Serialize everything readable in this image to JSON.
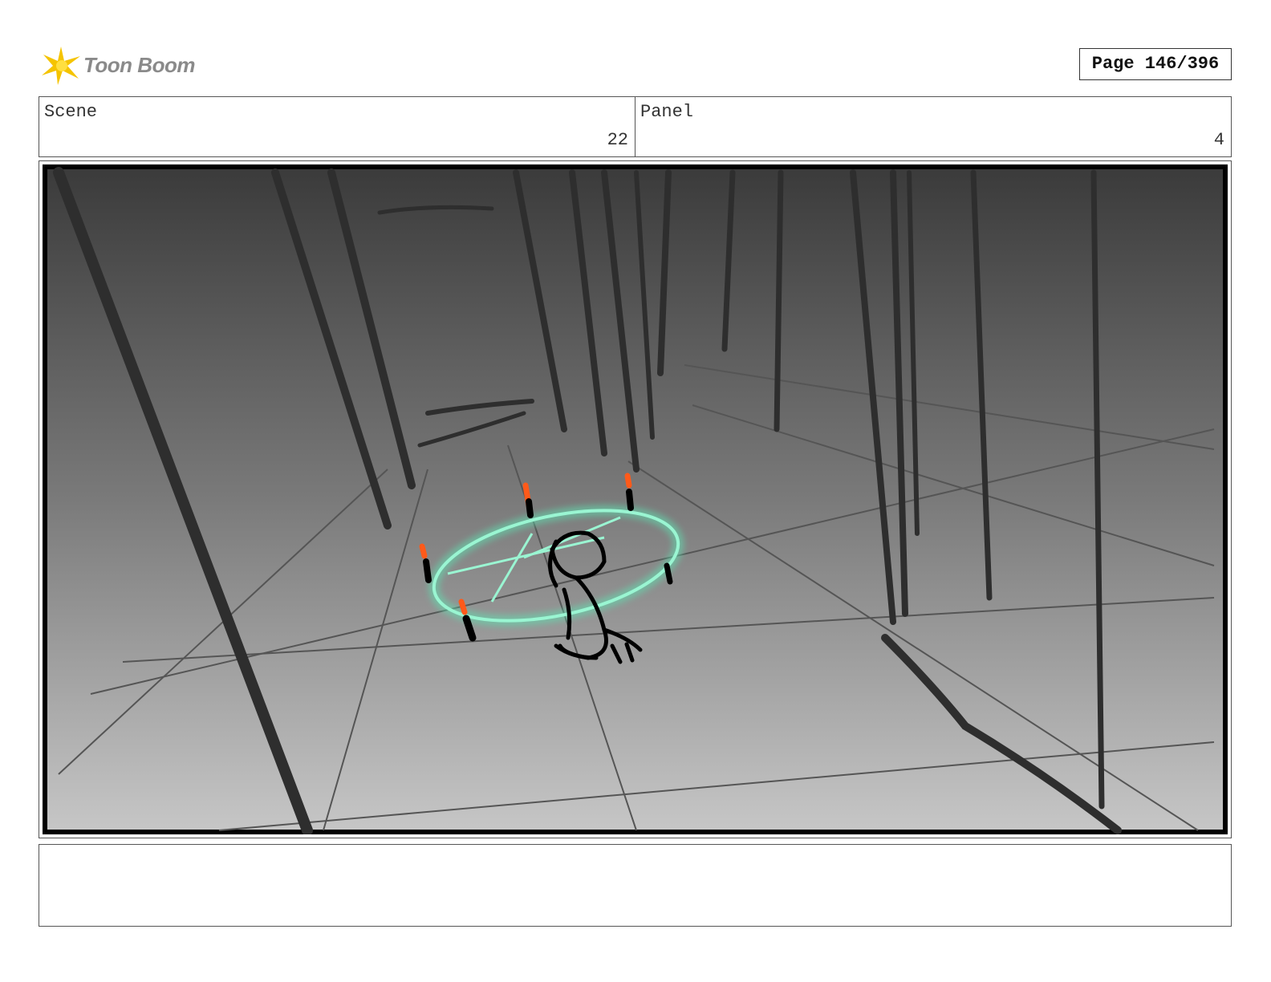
{
  "logo": {
    "text": "Toon Boom",
    "icon": "toon-boom-star-icon",
    "accent_color": "#f5c400"
  },
  "page": {
    "label": "Page 146/396"
  },
  "header": {
    "scene": {
      "label": "Scene",
      "value": "22"
    },
    "panel": {
      "label": "Panel",
      "value": "4"
    }
  },
  "drawing": {
    "description_colors": {
      "floor_top": "#3d3d3d",
      "floor_bottom": "#c4c4c4",
      "magic_circle": "#8af0c8",
      "candle_flame": "#ff5a1a"
    }
  },
  "caption": {
    "text": ""
  }
}
